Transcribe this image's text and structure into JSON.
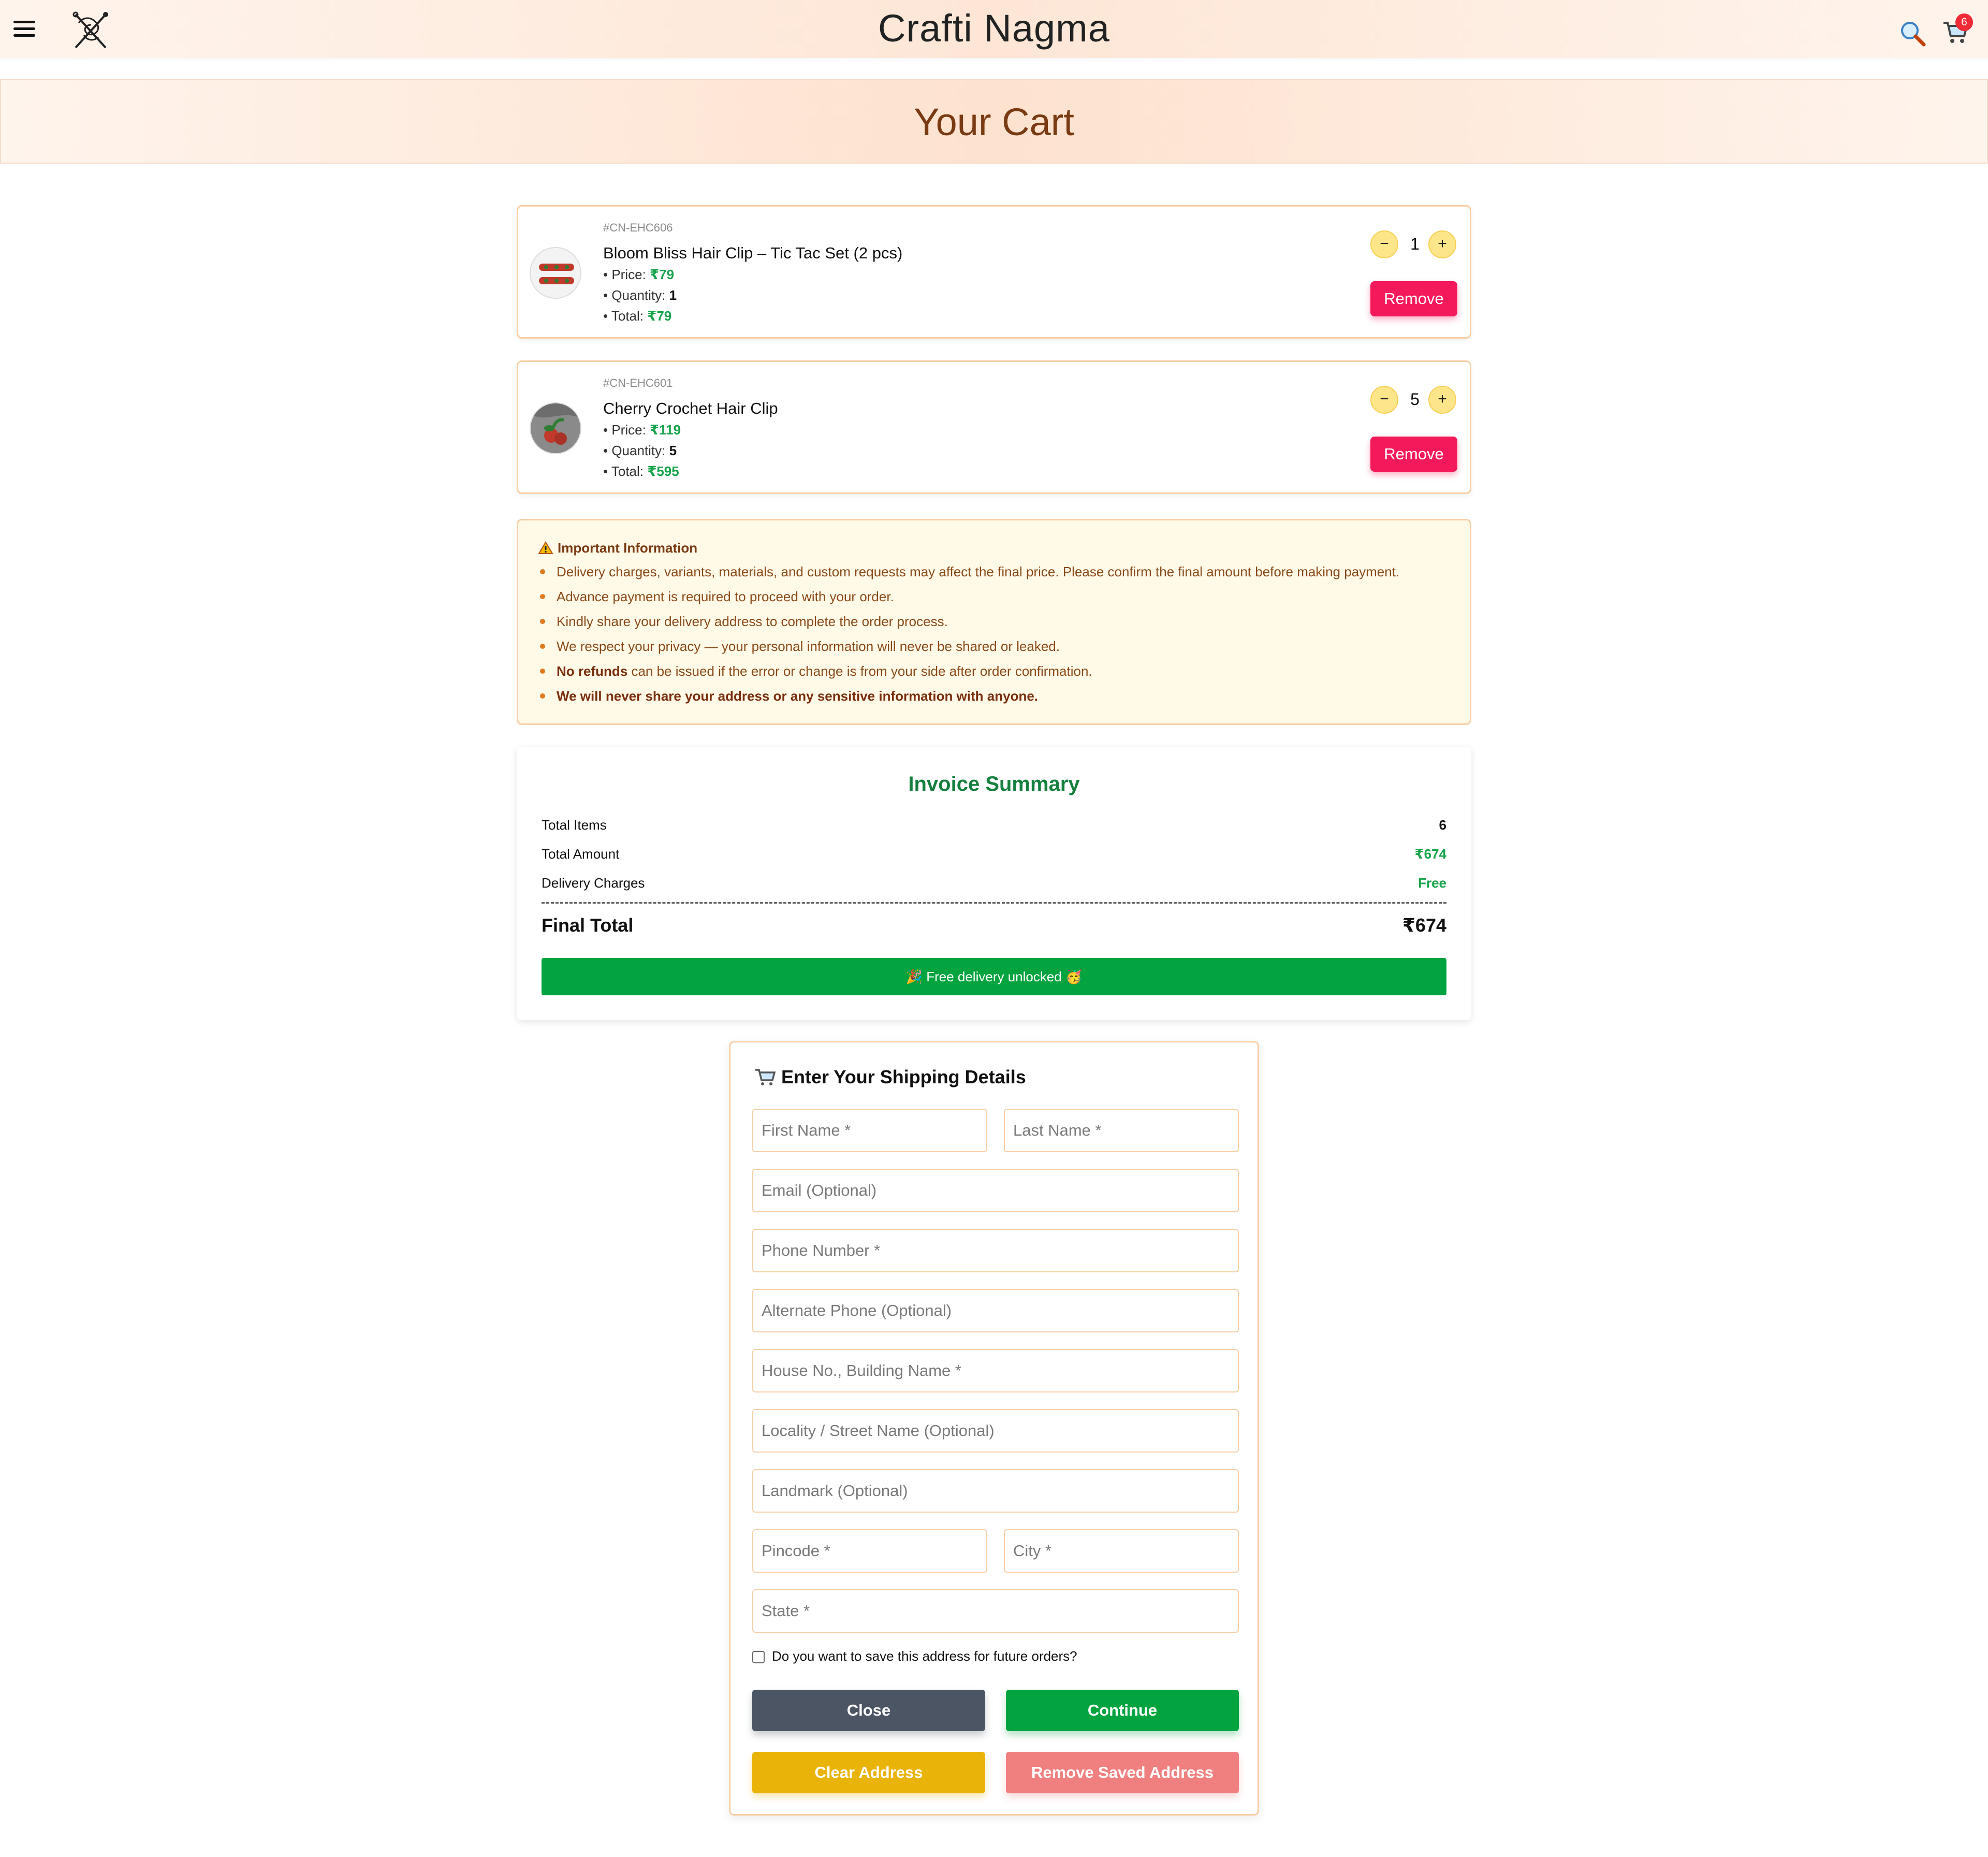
{
  "brand": "Crafti Nagma",
  "cart_count": "6",
  "page_title": "Your Cart",
  "items": [
    {
      "sku": "#CN-EHC606",
      "name": "Bloom Bliss Hair Clip – Tic Tac Set (2 pcs)",
      "price_label": "• Price: ",
      "price": "₹79",
      "quantity_label": "• Quantity: ",
      "quantity": "1",
      "total_label": "• Total: ",
      "total": "₹79",
      "qty_value": "1",
      "minus": "−",
      "plus": "+",
      "remove": "Remove"
    },
    {
      "sku": "#CN-EHC601",
      "name": "Cherry Crochet Hair Clip",
      "price_label": "• Price: ",
      "price": "₹119",
      "quantity_label": "• Quantity: ",
      "quantity": "5",
      "total_label": "• Total: ",
      "total": "₹595",
      "qty_value": "5",
      "minus": "−",
      "plus": "+",
      "remove": "Remove"
    }
  ],
  "info": {
    "title": "Important Information",
    "points": [
      "Delivery charges, variants, materials, and custom requests may affect the final price. Please confirm the final amount before making payment.",
      "Advance payment is required to proceed with your order.",
      "Kindly share your delivery address to complete the order process.",
      "We respect your privacy — your personal information will never be shared or leaked."
    ],
    "refund_bold": "No refunds",
    "refund_rest": " can be issued if the error or change is from your side after order confirmation.",
    "share_bold": "We will never share your address or any sensitive information with anyone."
  },
  "invoice": {
    "title": "Invoice Summary",
    "total_items_label": "Total Items",
    "total_items": "6",
    "total_amount_label": "Total Amount",
    "total_amount": "₹674",
    "delivery_label": "Delivery Charges",
    "delivery": "Free",
    "final_label": "Final Total",
    "final": "₹674",
    "free_banner": "🎉 Free delivery unlocked 🥳"
  },
  "shipping": {
    "title": "Enter Your Shipping Details",
    "first_name": "First Name *",
    "last_name": "Last Name *",
    "email": "Email (Optional)",
    "phone": "Phone Number *",
    "alt_phone": "Alternate Phone (Optional)",
    "house": "House No., Building Name *",
    "locality": "Locality / Street Name (Optional)",
    "landmark": "Landmark (Optional)",
    "pincode": "Pincode *",
    "city": "City *",
    "state": "State *",
    "save_label": "Do you want to save this address for future orders?",
    "close": "Close",
    "continue": "Continue",
    "clear": "Clear Address",
    "remove_saved": "Remove Saved Address"
  },
  "colors": {
    "accent_green": "#16a34a",
    "remove_pink": "#f4195a",
    "qty_yellow": "#fde68a",
    "close_gray": "#4b5563",
    "clear_amber": "#eab308",
    "remove_saved_pink": "#f08080"
  }
}
